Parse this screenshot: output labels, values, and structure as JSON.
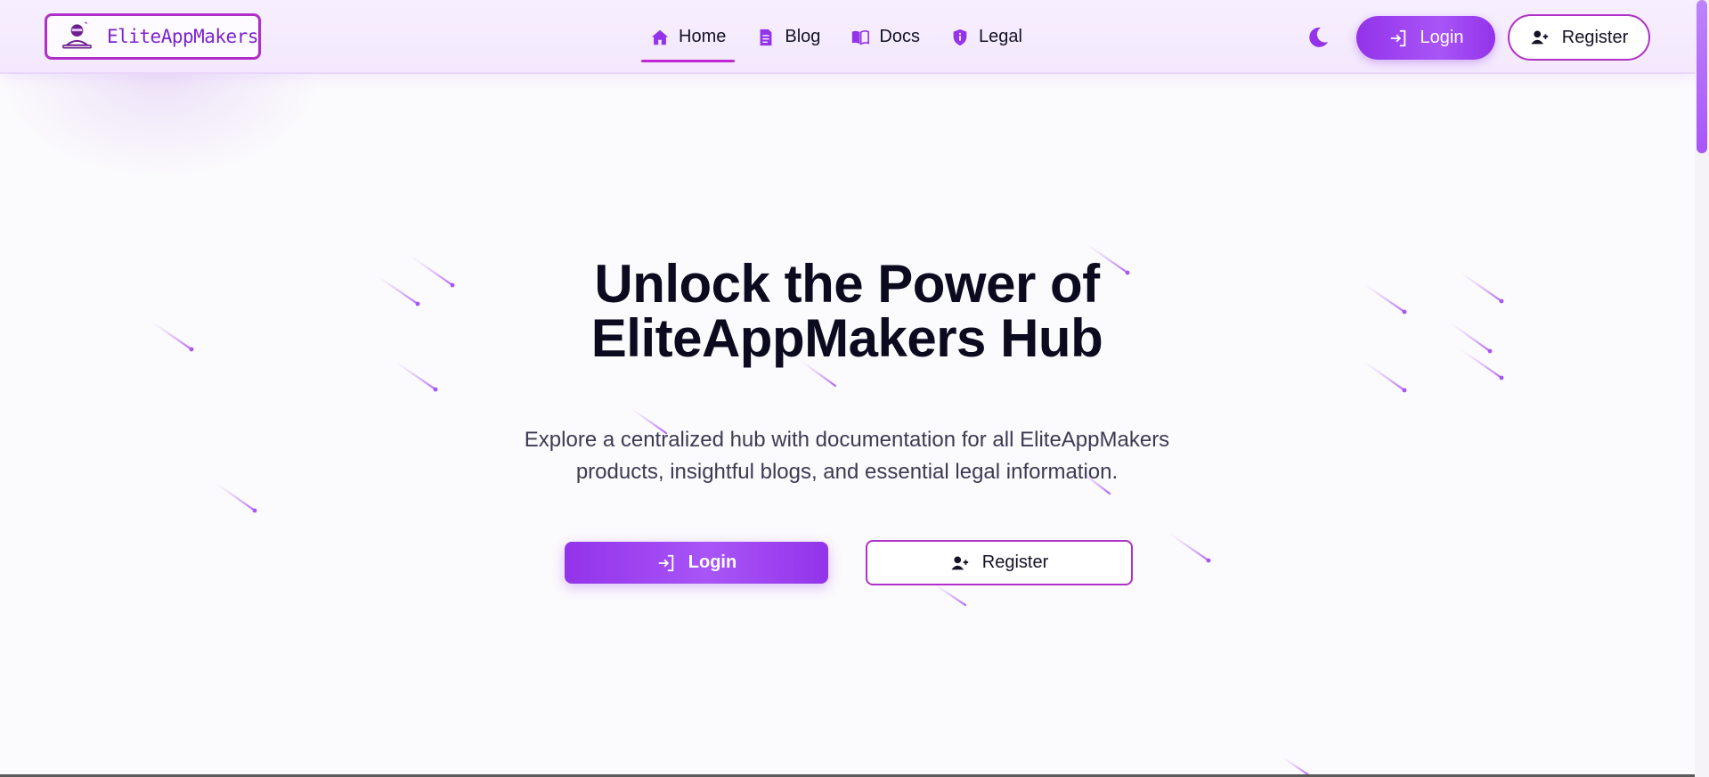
{
  "brand": {
    "name": "EliteAppMakers",
    "logo_icon": "person-at-laptop-icon"
  },
  "nav": {
    "items": [
      {
        "label": "Home",
        "icon": "home-icon",
        "active": true
      },
      {
        "label": "Blog",
        "icon": "document-icon",
        "active": false
      },
      {
        "label": "Docs",
        "icon": "book-open-icon",
        "active": false
      },
      {
        "label": "Legal",
        "icon": "shield-icon",
        "active": false
      }
    ]
  },
  "header_actions": {
    "theme_icon": "moon-icon",
    "login_label": "Login",
    "login_icon": "login-arrow-icon",
    "register_label": "Register",
    "register_icon": "user-plus-icon"
  },
  "hero": {
    "title_line1": "Unlock the Power of",
    "title_line2": "EliteAppMakers Hub",
    "subtitle_line1": "Explore a centralized hub with documentation for all EliteAppMakers",
    "subtitle_line2": "products, insightful blogs, and essential legal information.",
    "login_label": "Login",
    "register_label": "Register"
  },
  "colors": {
    "accent": "#9333ea",
    "accent_light": "#a855f7",
    "border_magenta": "#b12fc9",
    "header_bg": "#f5ecfe",
    "page_bg": "#fbfafc",
    "text_dark": "#0b0a1e"
  }
}
